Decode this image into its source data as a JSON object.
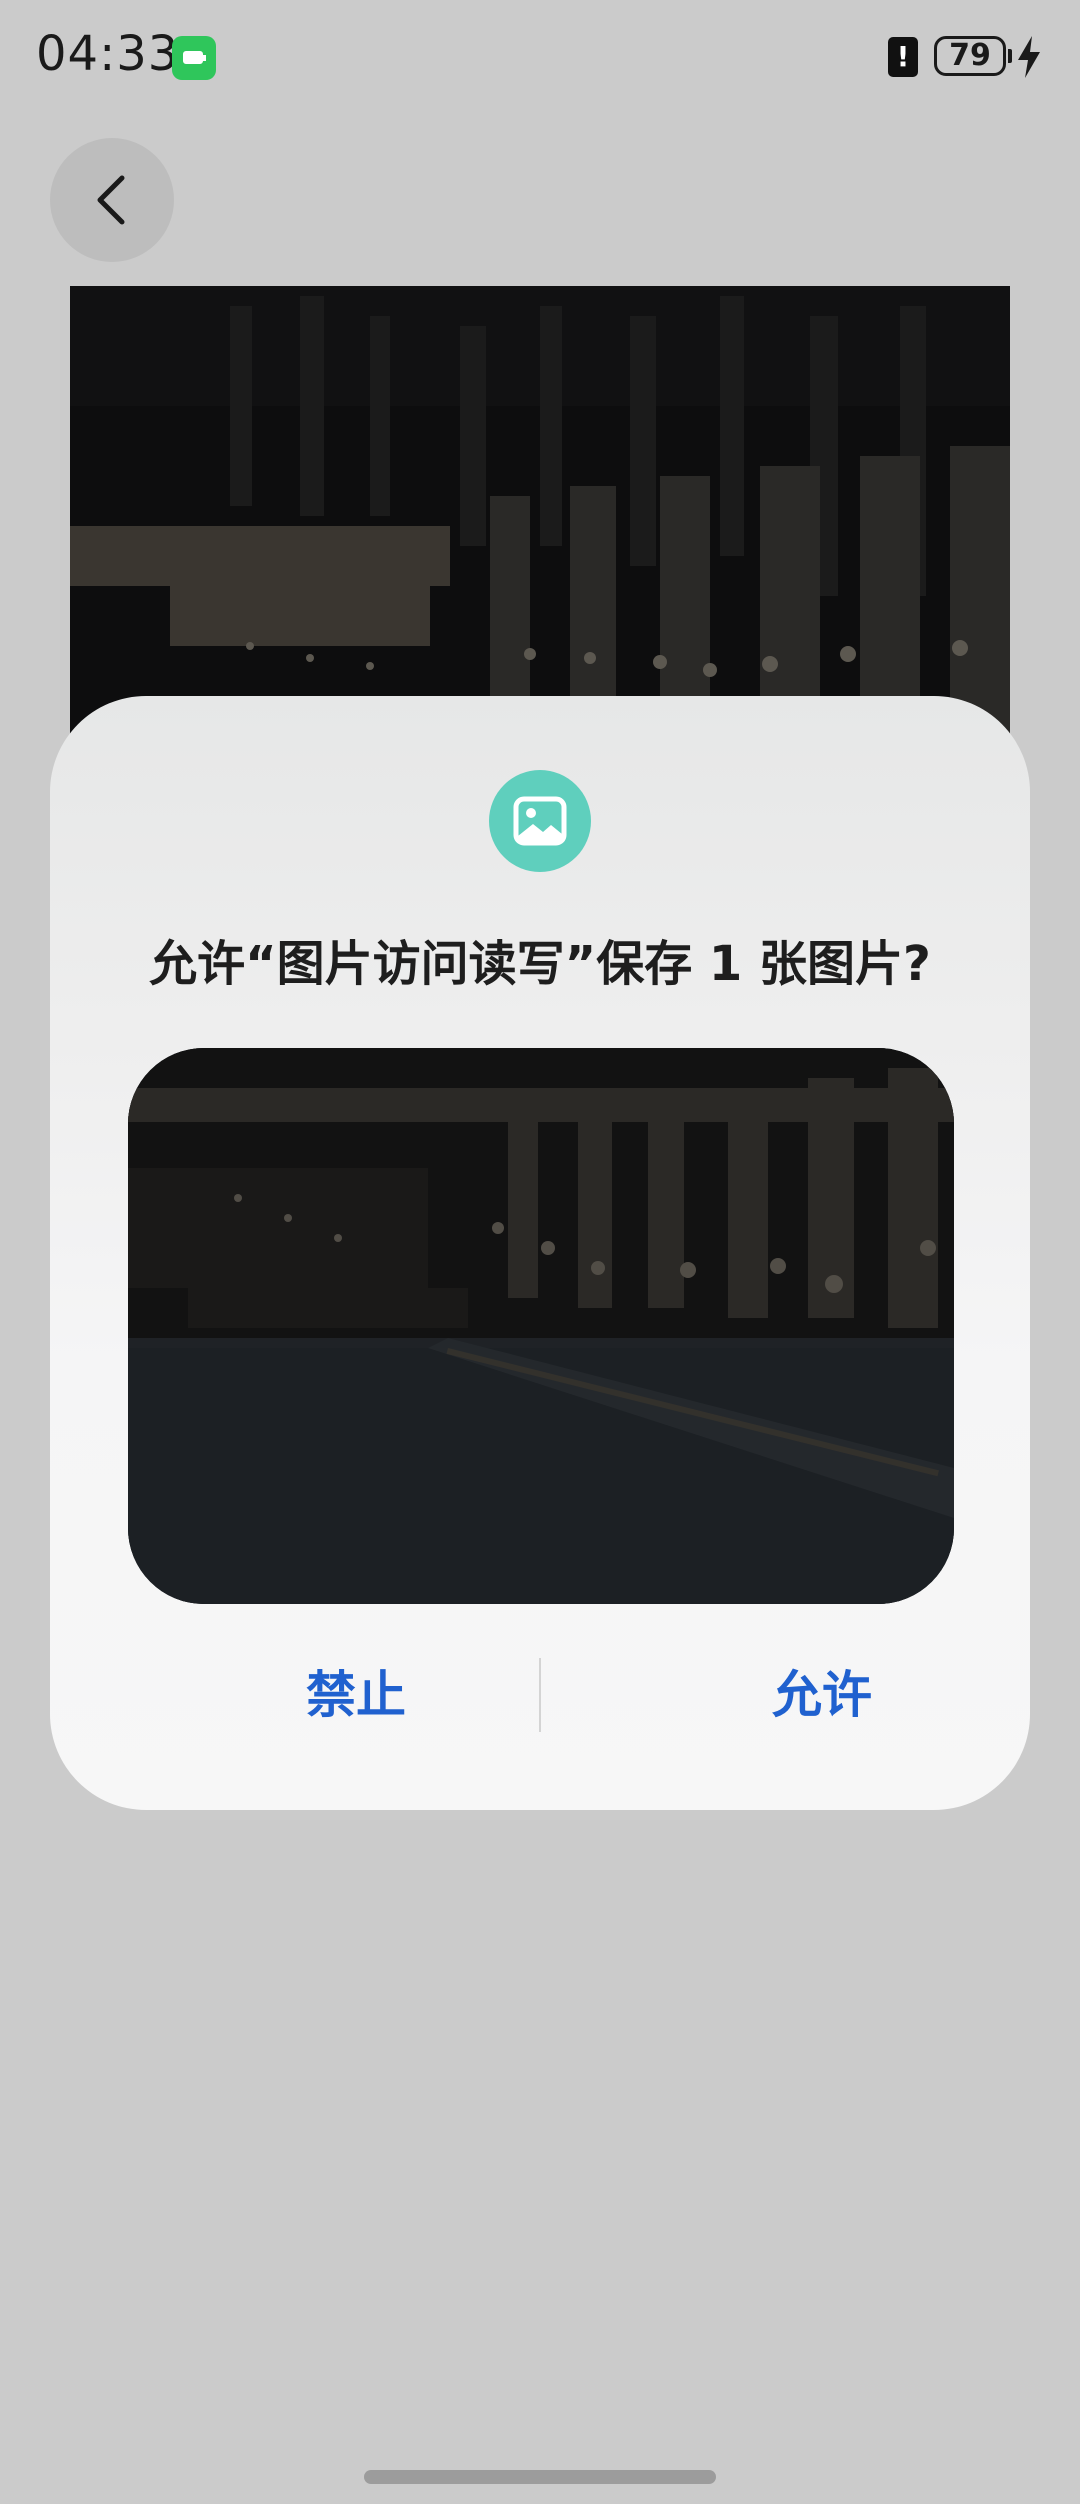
{
  "status_bar": {
    "time": "04:33",
    "battery_level": "79",
    "alert_symbol": "!",
    "icons": [
      "battery-saver-app-icon",
      "alert-card-icon",
      "battery-icon",
      "charging-icon"
    ]
  },
  "navigation": {
    "back_icon": "chevron-left-icon"
  },
  "dialog": {
    "icon": "image-icon",
    "title": "允许“图片访问读写”保存 1 张图片?",
    "deny_label": "禁止",
    "allow_label": "允许"
  },
  "colors": {
    "accent_blue": "#2061cf",
    "icon_teal": "#5fcfbd",
    "status_green": "#2fc65b"
  }
}
